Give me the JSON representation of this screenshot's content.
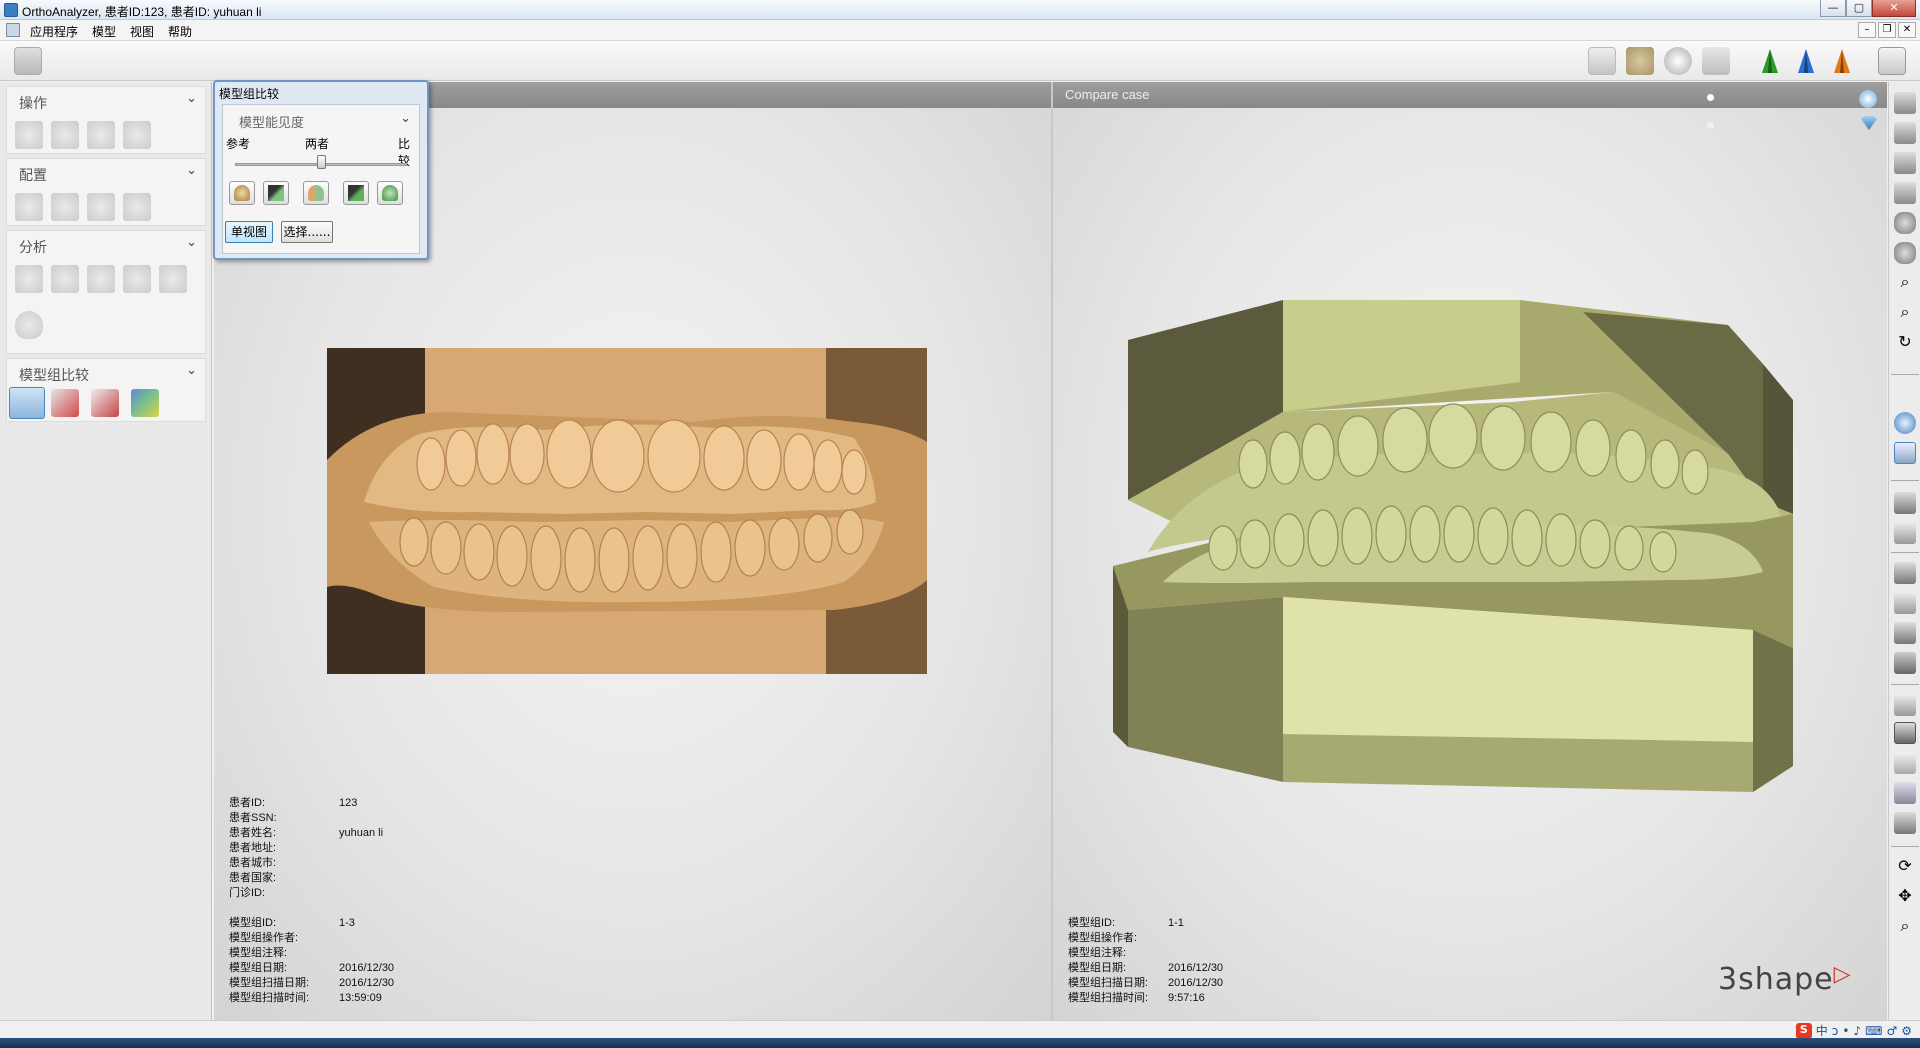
{
  "window": {
    "title": "OrthoAnalyzer, 患者ID:123, 患者ID: yuhuan li",
    "controls": {
      "minimize": "—",
      "maximize": "▢",
      "close": "✕"
    }
  },
  "menu": {
    "items": [
      "应用程序",
      "模型",
      "视图",
      "帮助"
    ]
  },
  "left_panel": {
    "sections": [
      {
        "title": "操作"
      },
      {
        "title": "配置"
      },
      {
        "title": "分析"
      },
      {
        "title": "模型组比较"
      }
    ]
  },
  "compare_panel": {
    "title": "模型组比较",
    "dropdown_value": "模型能见度",
    "slider_labels": {
      "left": "参考",
      "mid": "两者",
      "right": "比较"
    },
    "buttons": {
      "single_view": "单视图",
      "select": "选择......"
    }
  },
  "viewport_right": {
    "header": "Compare case"
  },
  "patient_info": {
    "rows": [
      {
        "k": "患者ID:",
        "v": "123"
      },
      {
        "k": "患者SSN:",
        "v": ""
      },
      {
        "k": "患者姓名:",
        "v": "yuhuan li"
      },
      {
        "k": "患者地址:",
        "v": ""
      },
      {
        "k": "患者城市:",
        "v": ""
      },
      {
        "k": "患者国家:",
        "v": ""
      },
      {
        "k": "门诊ID:",
        "v": ""
      }
    ]
  },
  "model_info_left": {
    "rows": [
      {
        "k": "模型组ID:",
        "v": "1-3"
      },
      {
        "k": "模型组操作者:",
        "v": ""
      },
      {
        "k": "模型组注释:",
        "v": ""
      },
      {
        "k": "模型组日期:",
        "v": "2016/12/30"
      },
      {
        "k": "模型组扫描日期:",
        "v": "2016/12/30"
      },
      {
        "k": "模型组扫描时间:",
        "v": "13:59:09"
      }
    ]
  },
  "model_info_right": {
    "rows": [
      {
        "k": "模型组ID:",
        "v": "1-1"
      },
      {
        "k": "模型组操作者:",
        "v": ""
      },
      {
        "k": "模型组注释:",
        "v": ""
      },
      {
        "k": "模型组日期:",
        "v": "2016/12/30"
      },
      {
        "k": "模型组扫描日期:",
        "v": "2016/12/30"
      },
      {
        "k": "模型组扫描时间:",
        "v": "9:57:16"
      }
    ]
  },
  "logo": {
    "text": "3shape"
  },
  "tray": {
    "ime": "中",
    "items": [
      "ↄ",
      "•",
      "♪",
      "⌨",
      "♂",
      "⚙"
    ]
  },
  "colors": {
    "reference_model": "#d9a86a",
    "compare_model": "#c9d39a",
    "viewport_header": "#909090",
    "panel_border": "#6f96c6"
  }
}
